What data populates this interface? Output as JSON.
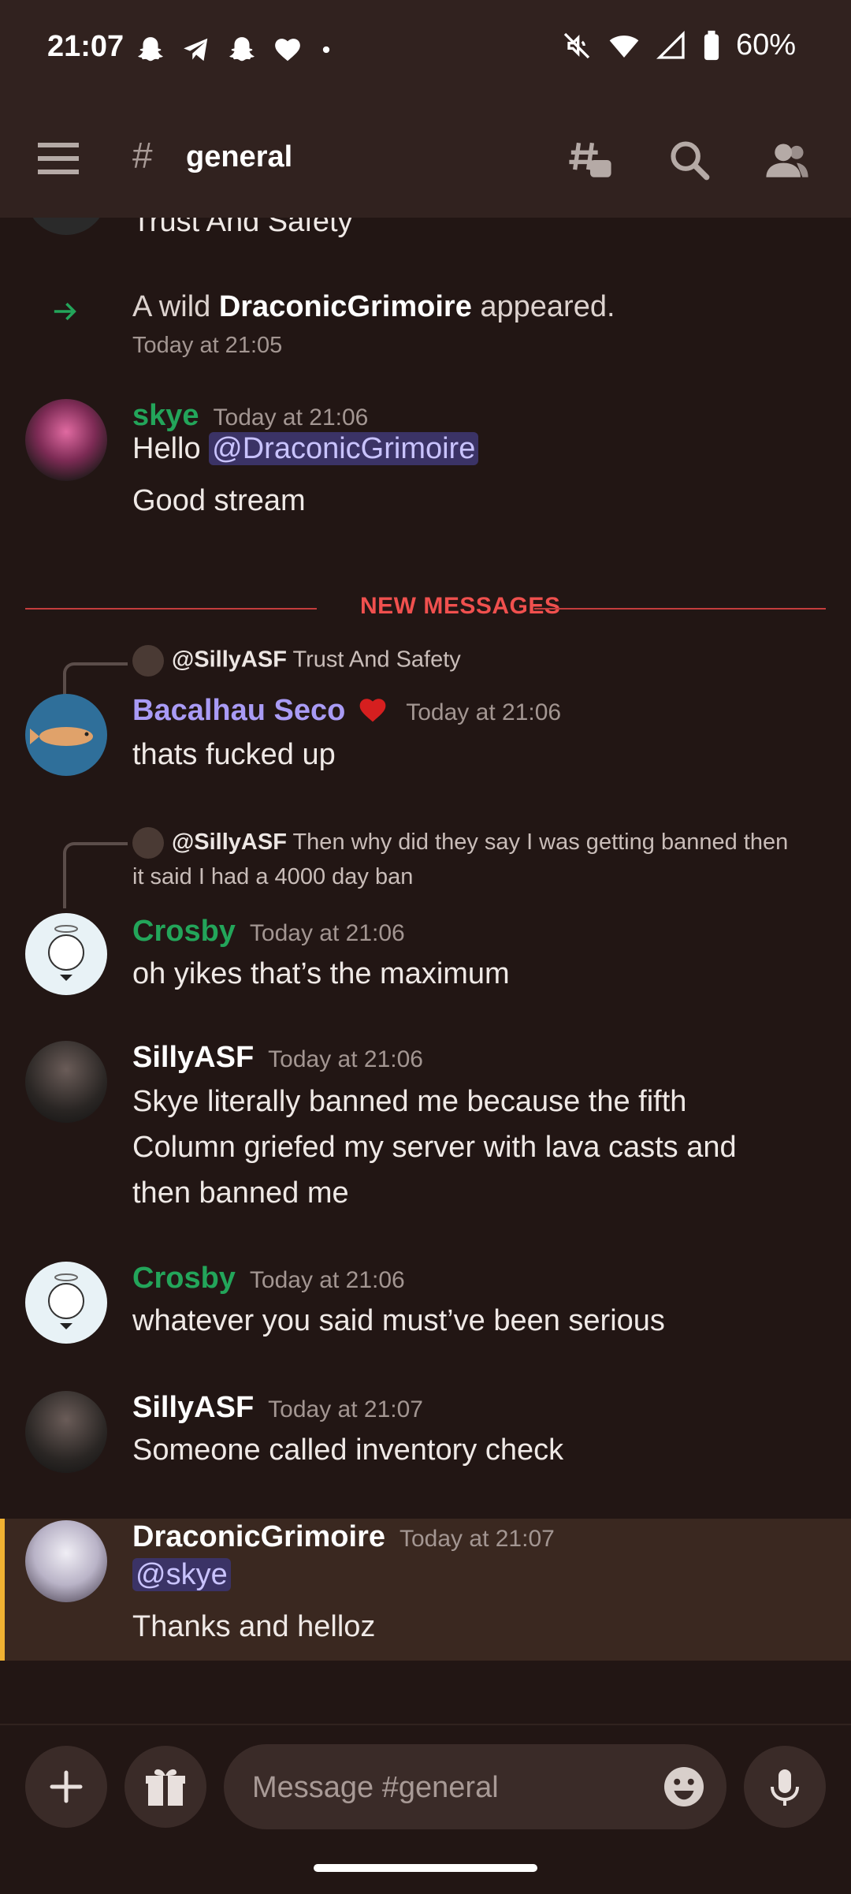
{
  "status": {
    "time": "21:07",
    "battery": "60%",
    "notification_icons": [
      "snapchat-icon",
      "telegram-icon",
      "snapchat-icon",
      "heart-icon",
      "dot-icon"
    ],
    "right_icons": [
      "mute-icon",
      "wifi-icon",
      "signal-icon",
      "battery-icon"
    ]
  },
  "header": {
    "hash": "#",
    "channel": "general"
  },
  "messages": {
    "m0": {
      "text": "Trust And Safety"
    },
    "join": {
      "prefix": "A wild ",
      "user": "DraconicGrimoire",
      "suffix": " appeared.",
      "timestamp": "Today at 21:05"
    },
    "skye": {
      "username": "skye",
      "color": "#23a55a",
      "timestamp": "Today at 21:06",
      "line1_prefix": "Hello ",
      "mention": "@DraconicGrimoire",
      "line2": "Good stream"
    },
    "divider": "NEW MESSAGES",
    "bacalhau": {
      "reply_user": "@SillyASF",
      "reply_text": "Trust And Safety",
      "username": "Bacalhau Seco",
      "color": "#a99bf5",
      "timestamp": "Today at 21:06",
      "text": "thats fucked up"
    },
    "crosby1": {
      "reply_user": "@SillyASF",
      "reply_text_1": "Then why did they say I was getting banned then",
      "reply_text_2": "it said I had a 4000 day ban",
      "username": "Crosby",
      "color": "#23a55a",
      "timestamp": "Today at 21:06",
      "text": "oh yikes that’s the maximum"
    },
    "silly1": {
      "username": "SillyASF",
      "timestamp": "Today at 21:06",
      "line1": "Skye literally banned me because the fifth",
      "line2": "Column griefed my server with lava casts and",
      "line3": "then banned me"
    },
    "crosby2": {
      "username": "Crosby",
      "timestamp": "Today at 21:06",
      "text": "whatever you said must’ve been serious"
    },
    "silly2": {
      "username": "SillyASF",
      "timestamp": "Today at 21:07",
      "text": "Someone called inventory check"
    },
    "draconic": {
      "username": "DraconicGrimoire",
      "timestamp": "Today at 21:07",
      "mention": "@skye",
      "text": "Thanks and helloz"
    }
  },
  "composer": {
    "placeholder": "Message #general"
  },
  "colors": {
    "background": "#221614",
    "bar": "#31221f",
    "new_messages": "#f0504e",
    "highlight_border": "#f0b132"
  }
}
